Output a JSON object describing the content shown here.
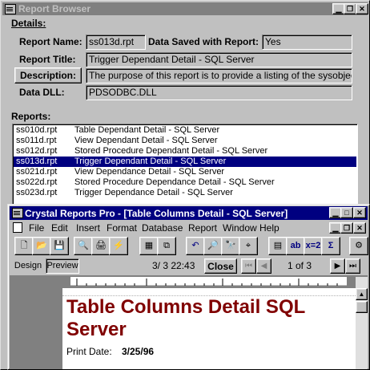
{
  "report_browser": {
    "title": "Report Browser",
    "details_label": "Details:",
    "report_name_label": "Report Name:",
    "report_name_value": "ss013d.rpt",
    "data_saved_label": "Data Saved with Report:",
    "data_saved_value": "Yes",
    "report_title_label": "Report Title:",
    "report_title_value": "Trigger Dependant Detail - SQL Server",
    "description_button": "Description:",
    "description_value": "The purpose of this report is to provide a listing of the sysobjects",
    "data_dll_label": "Data DLL:",
    "data_dll_value": "PDSODBC.DLL",
    "reports_label": "Reports:",
    "reports": [
      {
        "file": "ss010d.rpt",
        "title": "Table Dependant Detail - SQL Server",
        "selected": false
      },
      {
        "file": "ss011d.rpt",
        "title": "View Dependant Detail - SQL Server",
        "selected": false
      },
      {
        "file": "ss012d.rpt",
        "title": "Stored Procedure Dependant Detail - SQL Server",
        "selected": false
      },
      {
        "file": "ss013d.rpt",
        "title": "Trigger Dependant Detail - SQL Server",
        "selected": true
      },
      {
        "file": "ss021d.rpt",
        "title": "View Dependance Detail - SQL Server",
        "selected": false
      },
      {
        "file": "ss022d.rpt",
        "title": "Stored Procedure Dependance Detail - SQL Server",
        "selected": false
      },
      {
        "file": "ss023d.rpt",
        "title": "Trigger Dependance Detail - SQL Server",
        "selected": false
      }
    ]
  },
  "crystal": {
    "title": "Crystal Reports Pro - [Table Columns Detail - SQL Server]",
    "menu": [
      "File",
      "Edit",
      "Insert",
      "Format",
      "Database",
      "Report",
      "Window",
      "Help"
    ],
    "tabs": [
      "Design",
      "Preview"
    ],
    "datetime": "3/ 3 22:43",
    "close_button": "Close",
    "page_indicator": "1 of 3",
    "preview": {
      "report_title": "Table Columns Detail SQL Server",
      "print_date_label": "Print Date:",
      "print_date_value": "3/25/96"
    }
  },
  "colors": {
    "active_title": "#000080",
    "inactive_title": "#808080",
    "report_title_color": "#800000"
  }
}
